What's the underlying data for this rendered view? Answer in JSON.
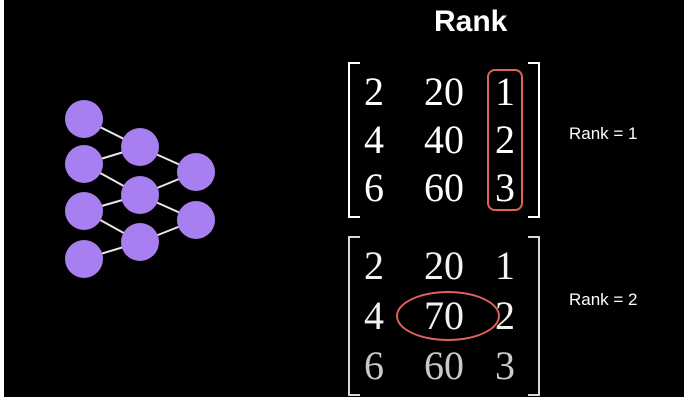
{
  "title": "Rank",
  "network": {
    "node_color": "#a77ff0",
    "edge_color": "#e8e8e8"
  },
  "matrices": [
    {
      "rows": [
        [
          "2",
          "20",
          "1"
        ],
        [
          "4",
          "40",
          "2"
        ],
        [
          "6",
          "60",
          "3"
        ]
      ],
      "label": "Rank = 1",
      "highlight": "third column"
    },
    {
      "rows": [
        [
          "2",
          "20",
          "1"
        ],
        [
          "4",
          "70",
          "2"
        ],
        [
          "6",
          "60",
          "3"
        ]
      ],
      "label": "Rank = 2",
      "highlight": "70"
    }
  ],
  "highlight_color": "#e0625a"
}
